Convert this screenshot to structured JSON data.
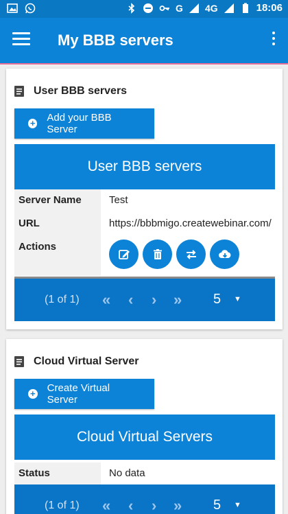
{
  "status_bar": {
    "time": "18:06",
    "network": "G",
    "network2": "4G",
    "icons": [
      "image-icon",
      "whatsapp-icon",
      "bluetooth-icon",
      "do-not-disturb-icon",
      "key-icon",
      "signal-icon",
      "battery-icon"
    ]
  },
  "app_bar": {
    "title": "My BBB servers",
    "menu_icon": "hamburger-icon",
    "overflow_icon": "more-vert-icon"
  },
  "user_section": {
    "header": "User BBB servers",
    "add_button": "Add your BBB Server",
    "table_title": "User BBB servers",
    "rows": [
      {
        "label": "Server Name",
        "value": "Test"
      },
      {
        "label": "URL",
        "value": "https://bbbmigo.createwebinar.com/"
      },
      {
        "label": "Actions",
        "value": ""
      }
    ],
    "actions": [
      "edit-icon",
      "delete-icon",
      "swap-icon",
      "cloud-download-icon"
    ],
    "pager": {
      "count": "(1 of 1)",
      "page_size": "5"
    }
  },
  "cloud_section": {
    "header": "Cloud Virtual Server",
    "create_button": "Create Virtual Server",
    "table_title": "Cloud Virtual Servers",
    "rows": [
      {
        "label": "Status",
        "value": "No data"
      }
    ],
    "pager": {
      "count": "(1 of 1)",
      "page_size": "5"
    }
  },
  "colors": {
    "primary": "#0c83d6",
    "status_bar": "#0a78c2",
    "pager": "#0a74c7",
    "accent_line": "#e56f98"
  }
}
